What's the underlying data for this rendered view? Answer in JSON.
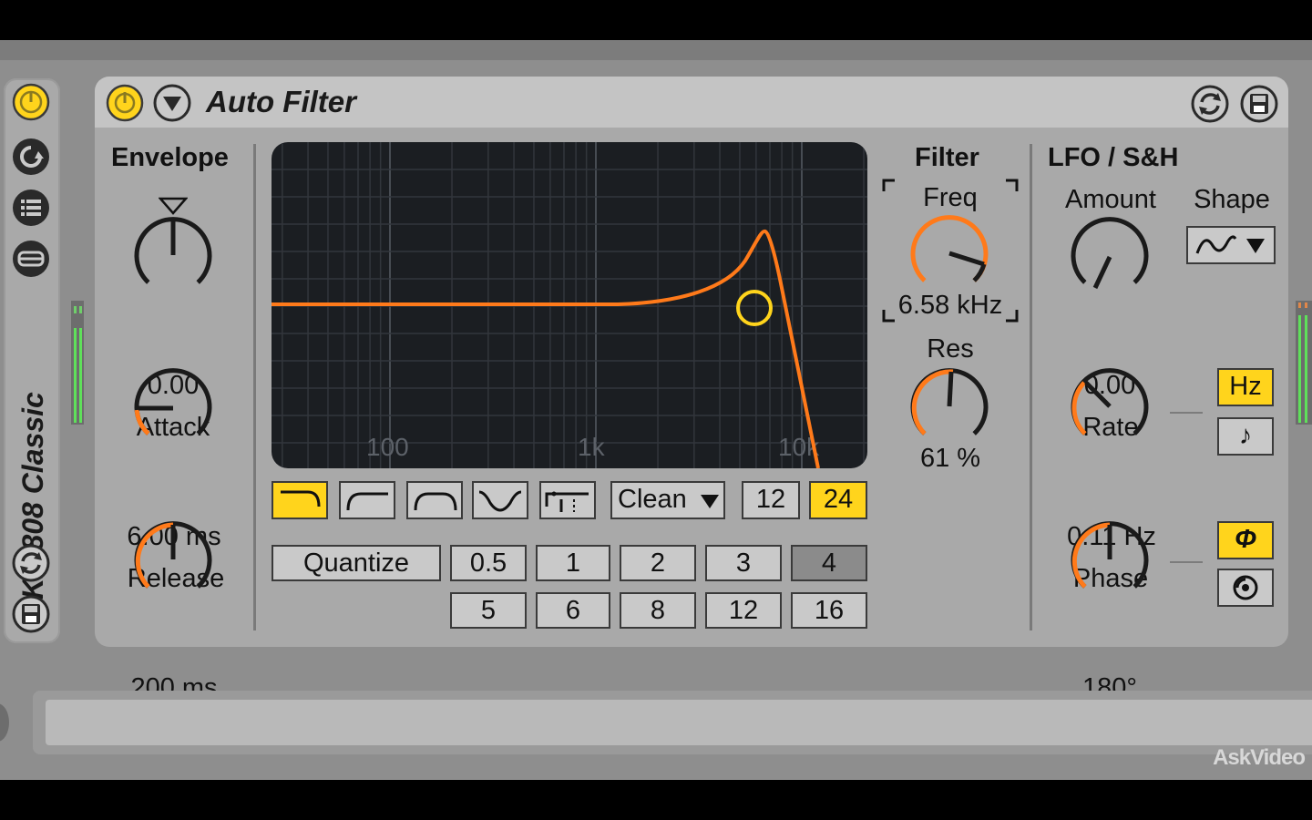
{
  "rack": {
    "name": "Kit-808 Classic",
    "icons": [
      "power-icon",
      "hot-swap-icon",
      "macro-list-icon",
      "chain-icon",
      "refresh-icon",
      "save-icon"
    ]
  },
  "device": {
    "title": "Auto Filter",
    "envelope": {
      "header": "Envelope",
      "amount": "0.00",
      "attack_label": "Attack",
      "attack_value": "6.00 ms",
      "release_label": "Release",
      "release_value": "200 ms"
    },
    "display": {
      "freq_labels": [
        "100",
        "1k",
        "10k"
      ]
    },
    "filter_types": [
      "lowpass",
      "highpass",
      "bandpass",
      "notch",
      "morph"
    ],
    "circuit": "Clean",
    "slope": {
      "options": [
        "12",
        "24"
      ],
      "selected": "24"
    },
    "quantize": {
      "label": "Quantize",
      "row1": [
        "0.5",
        "1",
        "2",
        "3",
        "4"
      ],
      "row2": [
        "5",
        "6",
        "8",
        "12",
        "16"
      ],
      "selected": "4"
    },
    "filter": {
      "header": "Filter",
      "freq_label": "Freq",
      "freq_value": "6.58 kHz",
      "res_label": "Res",
      "res_value": "61 %"
    },
    "lfo": {
      "header": "LFO / S&H",
      "amount_label": "Amount",
      "amount_value": "0.00",
      "shape_label": "Shape",
      "rate_label": "Rate",
      "rate_value": "0.11 Hz",
      "rate_mode_hz": "Hz",
      "rate_mode_sync": "♪",
      "phase_label": "Phase",
      "phase_value": "180°",
      "phase_mode": "Φ"
    }
  },
  "watermark": "AskVideo",
  "colors": {
    "accent": "#ffd41c",
    "curve": "#ff7a1a",
    "meter": "#5fe05a"
  }
}
